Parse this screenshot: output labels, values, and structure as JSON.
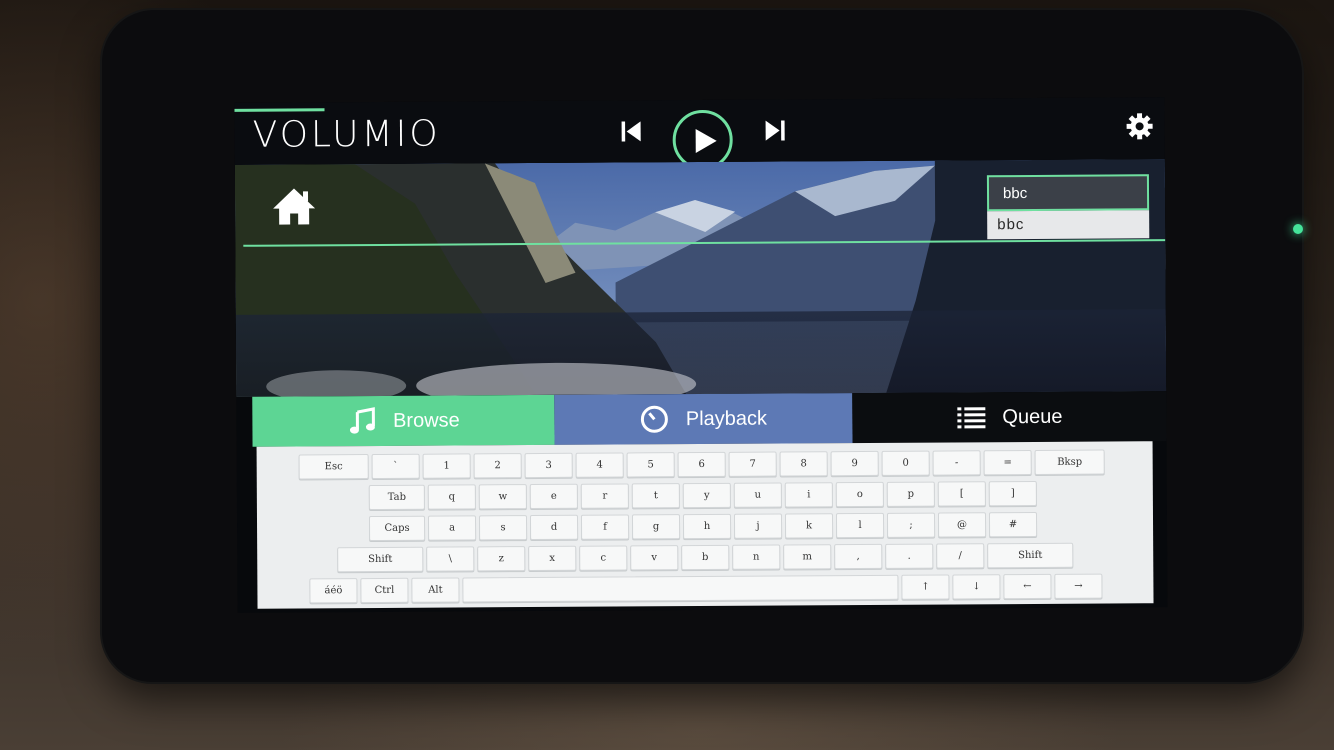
{
  "app": {
    "logo_text": "VOLUMIO"
  },
  "transport": {
    "prev_icon": "skip-back-icon",
    "play_icon": "play-icon",
    "next_icon": "skip-forward-icon",
    "settings_icon": "gear-icon"
  },
  "search": {
    "value": "bbc",
    "suggestion": "bbc"
  },
  "colors": {
    "accent": "#6fe0a0",
    "browse_tab": "#5dd594",
    "playback_tab": "#5d79b5"
  },
  "tabs": [
    {
      "label": "Browse",
      "icon": "music-note-icon"
    },
    {
      "label": "Playback",
      "icon": "clock-icon"
    },
    {
      "label": "Queue",
      "icon": "list-icon"
    }
  ],
  "keyboard": {
    "rows": [
      [
        "Esc",
        "`",
        "1",
        "2",
        "3",
        "4",
        "5",
        "6",
        "7",
        "8",
        "9",
        "0",
        "-",
        "=",
        "Bksp"
      ],
      [
        "Tab",
        "q",
        "w",
        "e",
        "r",
        "t",
        "y",
        "u",
        "i",
        "o",
        "p",
        "[",
        "]"
      ],
      [
        "Caps",
        "a",
        "s",
        "d",
        "f",
        "g",
        "h",
        "j",
        "k",
        "l",
        ";",
        "@",
        "#"
      ],
      [
        "Shift",
        "\\",
        "z",
        "x",
        "c",
        "v",
        "b",
        "n",
        "m",
        ",",
        ".",
        "/",
        "Shift"
      ],
      [
        "áéö",
        "Ctrl",
        "Alt",
        " ",
        "↑",
        "↓",
        "←",
        "→"
      ]
    ]
  }
}
